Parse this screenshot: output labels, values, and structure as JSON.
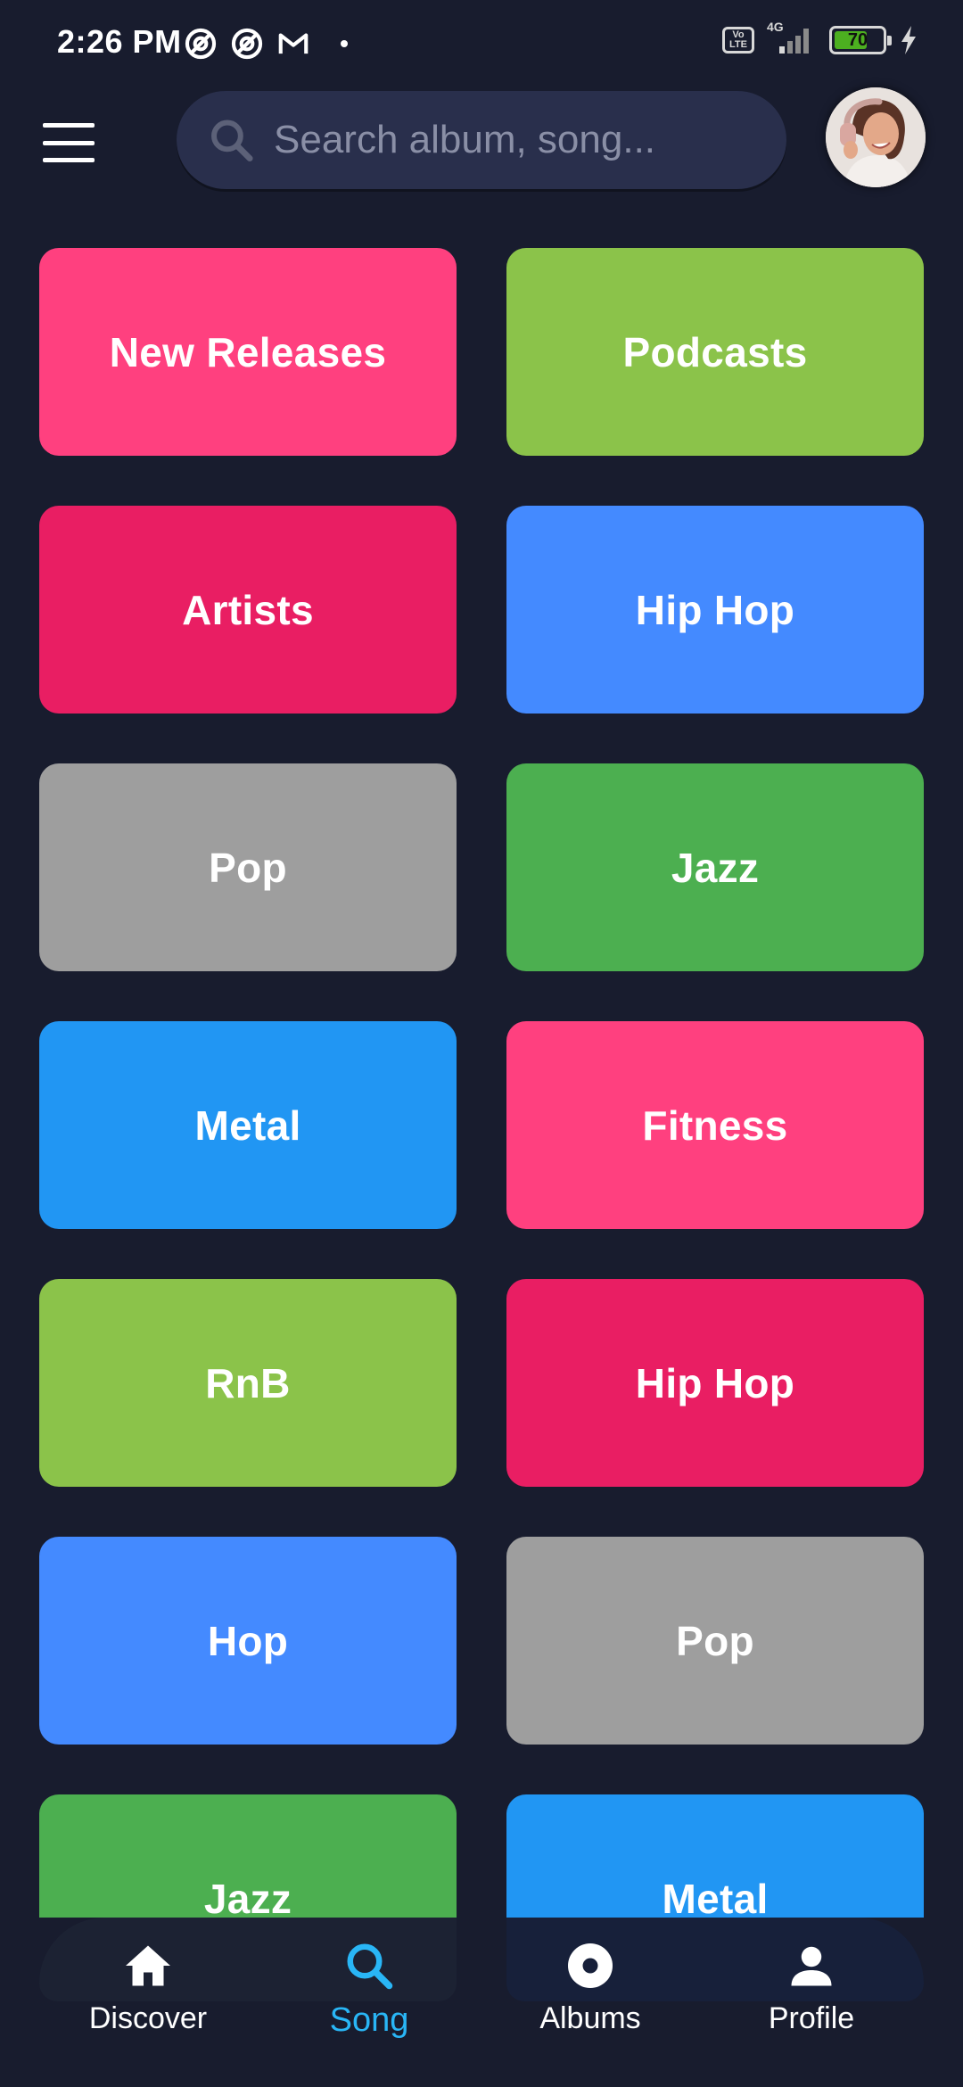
{
  "status_bar": {
    "time": "2:26 PM",
    "network": "4G",
    "volte": "Vo LTE",
    "battery": "70",
    "icons": [
      "notification-icon",
      "notification-icon",
      "gmail-icon",
      "signal-icon",
      "charging-icon"
    ]
  },
  "header": {
    "search_placeholder": "Search album, song...",
    "menu_icon": "hamburger-menu-icon",
    "search_icon": "search-icon",
    "avatar_icon": "user-avatar"
  },
  "categories": [
    {
      "label": "New Releases",
      "color": "#ff407f"
    },
    {
      "label": "Podcasts",
      "color": "#8bc34a"
    },
    {
      "label": "Artists",
      "color": "#e91e63"
    },
    {
      "label": "Hip Hop",
      "color": "#448aff"
    },
    {
      "label": "Pop",
      "color": "#9e9e9e"
    },
    {
      "label": "Jazz",
      "color": "#4caf50"
    },
    {
      "label": "Metal",
      "color": "#2196f3"
    },
    {
      "label": "Fitness",
      "color": "#ff407f"
    },
    {
      "label": "RnB",
      "color": "#8bc34a"
    },
    {
      "label": "Hip Hop",
      "color": "#e91e63"
    },
    {
      "label": "Hop",
      "color": "#448aff"
    },
    {
      "label": "Pop",
      "color": "#9e9e9e"
    },
    {
      "label": "Jazz",
      "color": "#4caf50"
    },
    {
      "label": "Metal",
      "color": "#2196f3"
    }
  ],
  "bottom_nav": {
    "active_color": "#29b6f6",
    "items": [
      {
        "label": "Discover",
        "icon": "home-icon"
      },
      {
        "label": "Song",
        "icon": "search-icon",
        "active": true
      },
      {
        "label": "Albums",
        "icon": "disc-icon"
      },
      {
        "label": "Profile",
        "icon": "person-icon"
      }
    ]
  }
}
